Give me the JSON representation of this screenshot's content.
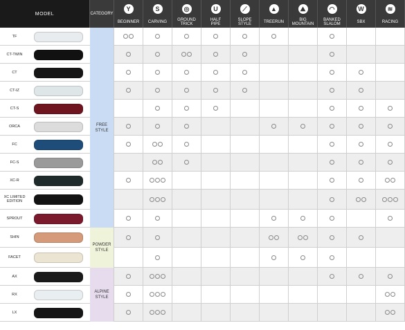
{
  "header": {
    "model_label": "MODEL",
    "category_label": "CATEGORY",
    "columns": [
      {
        "label": "BEGINNER",
        "icon": "beginner-icon",
        "glyph": "Y"
      },
      {
        "label": "CARVING",
        "icon": "carving-icon",
        "glyph": "S"
      },
      {
        "label": "GROUND TRICK",
        "icon": "ground-trick-icon",
        "glyph": "◎"
      },
      {
        "label": "HALF PIPE",
        "icon": "half-pipe-icon",
        "glyph": "U"
      },
      {
        "label": "SLOPE STYLE",
        "icon": "slope-style-icon",
        "glyph": "⟋"
      },
      {
        "label": "TREERUN",
        "icon": "treerun-icon",
        "glyph": "▲"
      },
      {
        "label": "BIG MOUNTAIN",
        "icon": "big-mountain-icon",
        "glyph": "⛰"
      },
      {
        "label": "BANKED SLALOM",
        "icon": "banked-slalom-icon",
        "glyph": "◠"
      },
      {
        "label": "SBX",
        "icon": "sbx-icon",
        "glyph": "W"
      },
      {
        "label": "RACING",
        "icon": "racing-icon",
        "glyph": "≋"
      }
    ]
  },
  "categories": [
    {
      "label": "FREE STYLE",
      "color": "#c9dcf3",
      "rows": [
        0,
        10
      ]
    },
    {
      "label": "POWDER STYLE",
      "color": "#eef3d9",
      "rows": [
        11,
        12
      ]
    },
    {
      "label": "ALPINE STYLE",
      "color": "#e6dced",
      "rows": [
        13,
        15
      ]
    }
  ],
  "rows": [
    {
      "model": "TF",
      "board_color": "#e8ecef",
      "marks": [
        "oo",
        "o",
        "o",
        "o",
        "o",
        "o",
        "",
        "o",
        "",
        ""
      ]
    },
    {
      "model": "CT-TWIN",
      "board_color": "#111111",
      "marks": [
        "o",
        "o",
        "oo",
        "o",
        "o",
        "",
        "",
        "o",
        "",
        ""
      ]
    },
    {
      "model": "CT",
      "board_color": "#161616",
      "marks": [
        "o",
        "o",
        "o",
        "o",
        "o",
        "",
        "",
        "o",
        "o",
        ""
      ]
    },
    {
      "model": "CT-IZ",
      "board_color": "#dfe6e8",
      "marks": [
        "o",
        "o",
        "o",
        "o",
        "o",
        "",
        "",
        "o",
        "o",
        ""
      ]
    },
    {
      "model": "CT-S",
      "board_color": "#6e1520",
      "marks": [
        "",
        "o",
        "o",
        "o",
        "",
        "",
        "",
        "o",
        "o",
        "o"
      ]
    },
    {
      "model": "ORCA",
      "board_color": "#dcdcdc",
      "marks": [
        "o",
        "o",
        "o",
        "",
        "",
        "o",
        "o",
        "o",
        "o",
        "o"
      ]
    },
    {
      "model": "FC",
      "board_color": "#1f4d7a",
      "marks": [
        "o",
        "oo",
        "o",
        "",
        "",
        "",
        "",
        "o",
        "o",
        "o"
      ]
    },
    {
      "model": "FC-S",
      "board_color": "#9a9a9a",
      "marks": [
        "",
        "oo",
        "o",
        "",
        "",
        "",
        "",
        "o",
        "o",
        "o"
      ]
    },
    {
      "model": "XC-R",
      "board_color": "#1f2b2b",
      "marks": [
        "o",
        "ooo",
        "",
        "",
        "",
        "",
        "",
        "o",
        "o",
        "oo"
      ]
    },
    {
      "model": "XC LIMITED EDITION",
      "board_color": "#121212",
      "marks": [
        "",
        "ooo",
        "",
        "",
        "",
        "",
        "",
        "o",
        "oo",
        "ooo"
      ]
    },
    {
      "model": "SPROUT",
      "board_color": "#7a1a2c",
      "marks": [
        "o",
        "o",
        "",
        "",
        "",
        "o",
        "o",
        "o",
        "",
        "o"
      ]
    },
    {
      "model": "SHIN",
      "board_color": "#d49a7a",
      "marks": [
        "o",
        "o",
        "",
        "",
        "",
        "oo",
        "oo",
        "o",
        "o",
        ""
      ]
    },
    {
      "model": "FACET",
      "board_color": "#ece4d2",
      "marks": [
        "",
        "o",
        "",
        "",
        "",
        "o",
        "o",
        "o",
        "",
        ""
      ]
    },
    {
      "model": "AX",
      "board_color": "#1a1a1a",
      "marks": [
        "o",
        "ooo",
        "",
        "",
        "",
        "",
        "",
        "o",
        "o",
        "o"
      ]
    },
    {
      "model": "RX",
      "board_color": "#e9eef0",
      "marks": [
        "o",
        "ooo",
        "",
        "",
        "",
        "",
        "",
        "",
        "",
        "oo"
      ]
    },
    {
      "model": "LX",
      "board_color": "#161616",
      "marks": [
        "o",
        "ooo",
        "",
        "",
        "",
        "",
        "",
        "",
        "",
        "oo"
      ]
    }
  ]
}
